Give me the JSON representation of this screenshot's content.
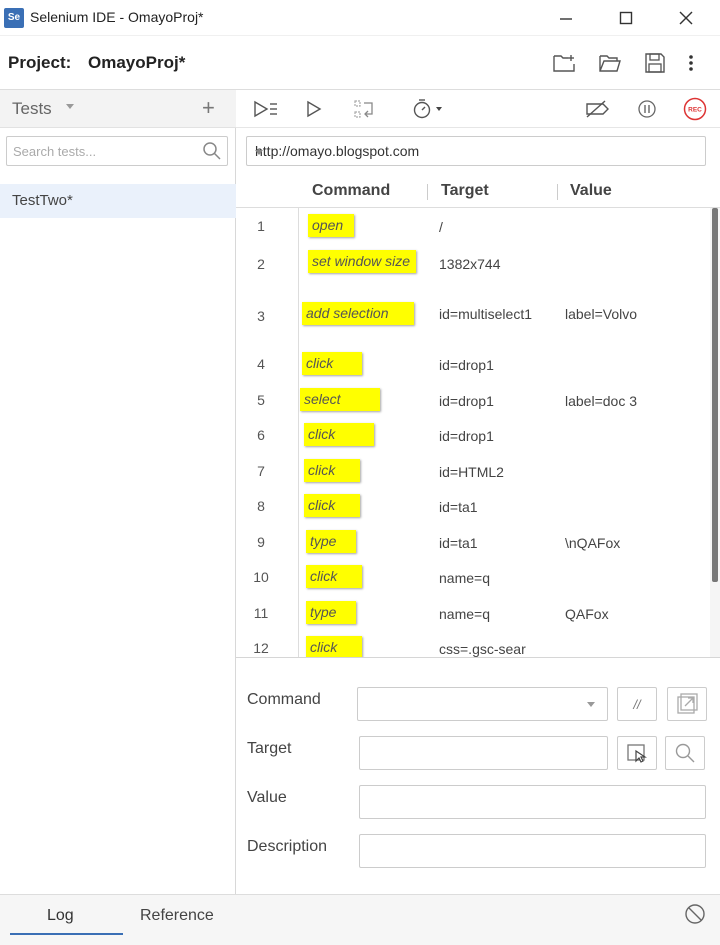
{
  "window": {
    "logo": "Se",
    "title": "Selenium IDE - OmayoProj*"
  },
  "project": {
    "label": "Project:",
    "name": "OmayoProj*"
  },
  "sidebar": {
    "tests_label": "Tests",
    "search_placeholder": "Search tests...",
    "tests": [
      "TestTwo*"
    ]
  },
  "url": "http://omayo.blogspot.com",
  "table": {
    "headers": {
      "command": "Command",
      "target": "Target",
      "value": "Value"
    },
    "rows": [
      {
        "num": "1",
        "command": "open",
        "target": "/",
        "value": ""
      },
      {
        "num": "2",
        "command": "set window size",
        "target": "1382x744",
        "value": ""
      },
      {
        "num": "3",
        "command": "add selection",
        "target": "id=multiselect1",
        "value": "label=Volvo"
      },
      {
        "num": "4",
        "command": "click",
        "target": "id=drop1",
        "value": ""
      },
      {
        "num": "5",
        "command": "select",
        "target": "id=drop1",
        "value": "label=doc 3"
      },
      {
        "num": "6",
        "command": "click",
        "target": "id=drop1",
        "value": ""
      },
      {
        "num": "7",
        "command": "click",
        "target": "id=HTML2",
        "value": ""
      },
      {
        "num": "8",
        "command": "click",
        "target": "id=ta1",
        "value": ""
      },
      {
        "num": "9",
        "command": "type",
        "target": "id=ta1",
        "value": "\\nQAFox"
      },
      {
        "num": "10",
        "command": "click",
        "target": "name=q",
        "value": ""
      },
      {
        "num": "11",
        "command": "type",
        "target": "name=q",
        "value": "QAFox"
      },
      {
        "num": "12",
        "command": "click",
        "target": "css=.gsc-sear",
        "value": ""
      }
    ]
  },
  "editor": {
    "command_label": "Command",
    "target_label": "Target",
    "value_label": "Value",
    "description_label": "Description",
    "comment_button": "//"
  },
  "toolbar": {
    "record_label": "REC"
  },
  "bottom": {
    "log_tab": "Log",
    "reference_tab": "Reference"
  }
}
